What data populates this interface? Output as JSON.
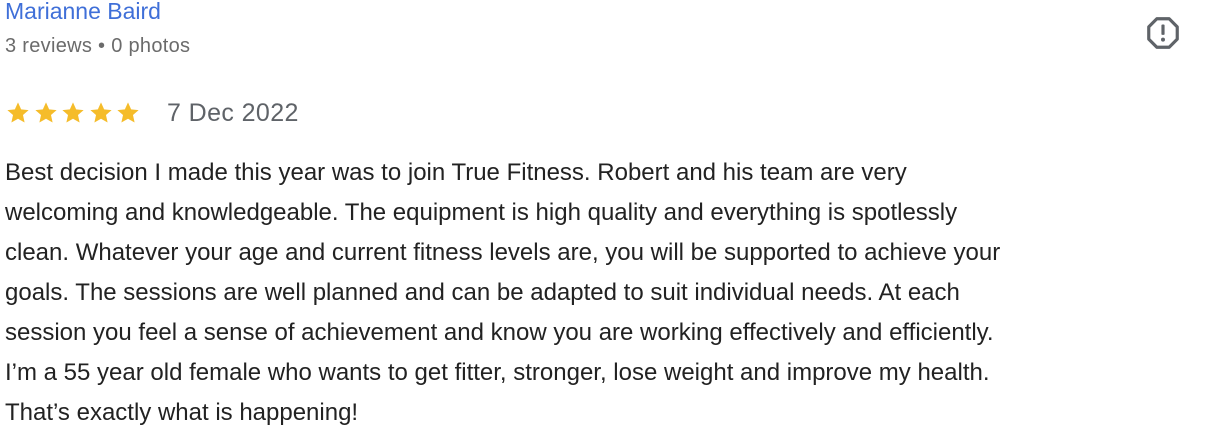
{
  "review": {
    "reviewer_name": "Marianne Baird",
    "reviewer_meta": "3 reviews • 0 photos",
    "rating": 5,
    "rating_max": 5,
    "date": "7 Dec 2022",
    "text_lines": [
      "Best decision I made this year was to join True Fitness. Robert and his team are very",
      "welcoming and knowledgeable. The equipment is high quality and everything is spotlessly",
      "clean. Whatever your age and current fitness levels are, you will be supported to achieve your",
      "goals. The sessions are well planned and can be adapted to suit individual needs. At each",
      "session you feel a sense of achievement and know you are working effectively and efficiently.",
      "I’m a 55 year old female who wants to get fitter, stronger, lose weight and improve my health.",
      "That’s exactly what is happening!"
    ]
  },
  "icons": {
    "report": "report-flag-icon",
    "star": "star-icon"
  },
  "colors": {
    "name_link": "#3f6fd8",
    "star_fill": "#f5bc2a",
    "meta_text": "#6b6b6b",
    "body_text": "#222222",
    "report_icon": "#5f6368"
  }
}
